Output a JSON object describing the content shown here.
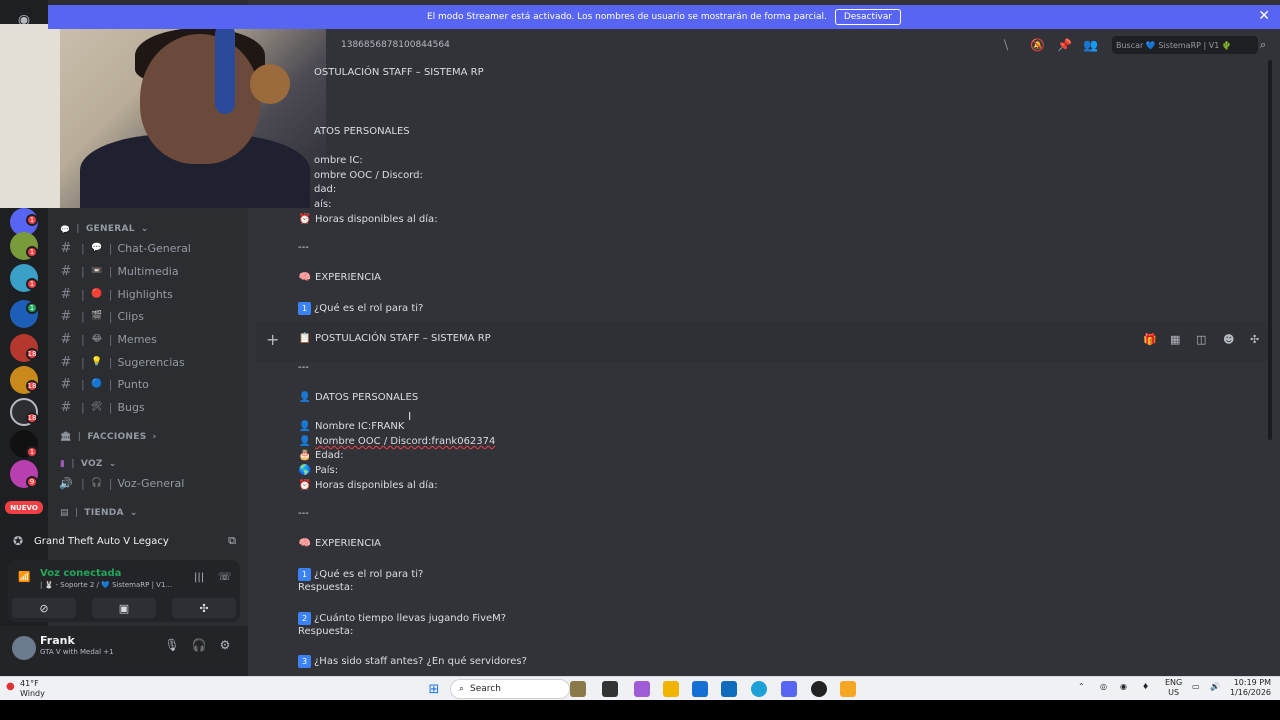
{
  "banner": {
    "text": "El modo Streamer está activado. Los nombres de usuario se mostrarán de forma parcial.",
    "button": "Desactivar",
    "close": "✕"
  },
  "rail": {
    "nuevo": "NUEVO",
    "badges": [
      "1",
      "1",
      "1",
      "1",
      "18",
      "18",
      "18",
      "1",
      "9"
    ]
  },
  "sidebar": {
    "categories": {
      "general": "GENERAL",
      "facciones": "FACCIONES",
      "voz": "VOZ",
      "tienda": "TIENDA"
    },
    "channels": [
      {
        "emoji": "💬",
        "label": "Chat-General"
      },
      {
        "emoji": "📼",
        "label": "Multimedia"
      },
      {
        "emoji": "🔴",
        "label": "Highlights"
      },
      {
        "emoji": "🎬",
        "label": "Clips"
      },
      {
        "emoji": "😂",
        "label": "Memes"
      },
      {
        "emoji": "💡",
        "label": "Sugerencias"
      },
      {
        "emoji": "🔵",
        "label": "Punto"
      },
      {
        "emoji": "🛠",
        "label": "Bugs"
      }
    ],
    "voice_channel": {
      "emoji": "🎧",
      "label": "Voz-General"
    }
  },
  "activity": {
    "title": "Grand Theft Auto V Legacy"
  },
  "voice": {
    "status": "Voz conectada",
    "location": "| 🐰 - Soporte 2 / 💙 SistemaRP | V1..."
  },
  "user": {
    "name": "Frank",
    "status": "GTA V with Medal +1"
  },
  "header": {
    "channel_id": "1386856878100844564",
    "search_placeholder": "Buscar 💙 SistemaRP | V1 🌵"
  },
  "message_top": {
    "title": "OSTULACIÓN STAFF – SISTEMA RP",
    "datos": "ATOS PERSONALES",
    "nombre_ic": "ombre IC:",
    "nombre_ooc": "ombre OOC / Discord:",
    "edad": "dad:",
    "pais": "aís:",
    "horas": "Horas disponibles al día:",
    "sep": "---",
    "experiencia": "EXPERIENCIA",
    "q1": "¿Qué es el rol para ti?"
  },
  "message_main": {
    "title": "POSTULACIÓN STAFF – SISTEMA RP",
    "sep": "---",
    "datos": "DATOS PERSONALES",
    "nombre_ic": "Nombre IC:FRANK",
    "nombre_ooc": "Nombre OOC / Discord:frank062374",
    "edad": "Edad:",
    "pais": "País:",
    "horas": "Horas disponibles al día:",
    "experiencia": "EXPERIENCIA",
    "q1": "¿Qué es el rol para ti?",
    "respuesta": "Respuesta:",
    "q2": "¿Cuánto tiempo llevas jugando FiveM?",
    "q3": "¿Has sido staff antes? ¿En qué servidores?",
    "n1": "1",
    "n2": "2",
    "n3": "3"
  },
  "taskbar": {
    "temp": "41°F",
    "weather": "Windy",
    "search": "Search",
    "lang1": "ENG",
    "lang2": "US",
    "time": "10:19 PM",
    "date": "1/16/2026"
  }
}
